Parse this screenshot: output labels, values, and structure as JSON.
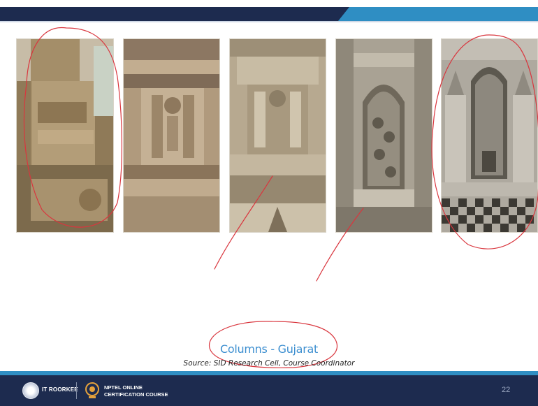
{
  "slide": {
    "caption": "Columns - Gujarat",
    "source": "Source: SID Research Cell, Course Coordinator",
    "page_number": "22"
  },
  "photos": [
    {
      "subject": "stone pillar base with carved panels",
      "tone": "#a08b68"
    },
    {
      "subject": "carved stone column with lamp niche motif",
      "tone": "#b29c80"
    },
    {
      "subject": "carved stone facade with tiered niches",
      "tone": "#b7a990"
    },
    {
      "subject": "carved arched niche with tree of life tracery",
      "tone": "#a9a294"
    },
    {
      "subject": "jali screen with tree of life and lattice base",
      "tone": "#aea99f"
    }
  ],
  "footer": {
    "institution": "IT ROORKEE",
    "program_line1": "NPTEL ONLINE",
    "program_line2": "CERTIFICATION COURSE"
  },
  "colors": {
    "header_dark": "#1d2b4f",
    "header_accent": "#2f8ec3",
    "caption_blue": "#3d8fd0",
    "annotation_red": "#d9363e"
  }
}
